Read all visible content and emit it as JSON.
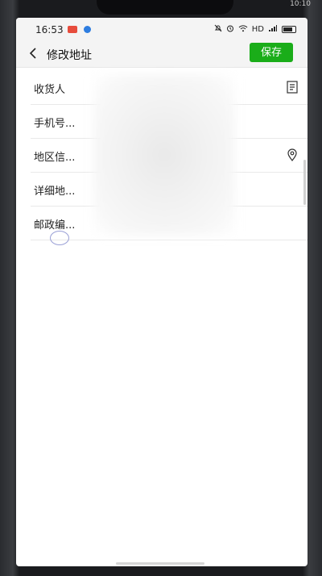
{
  "device": {
    "outer_time": "10:10"
  },
  "status_bar": {
    "time": "16:53",
    "network": "HD"
  },
  "header": {
    "title": "修改地址",
    "save_label": "保存"
  },
  "form": {
    "rows": [
      {
        "label": "收货人",
        "icon": "contact-book-icon"
      },
      {
        "label": "手机号...",
        "icon": ""
      },
      {
        "label": "地区信...",
        "icon": "location-pin-icon"
      },
      {
        "label": "详细地...",
        "icon": ""
      },
      {
        "label": "邮政编...",
        "icon": ""
      }
    ]
  },
  "colors": {
    "accent": "#1aad19"
  }
}
